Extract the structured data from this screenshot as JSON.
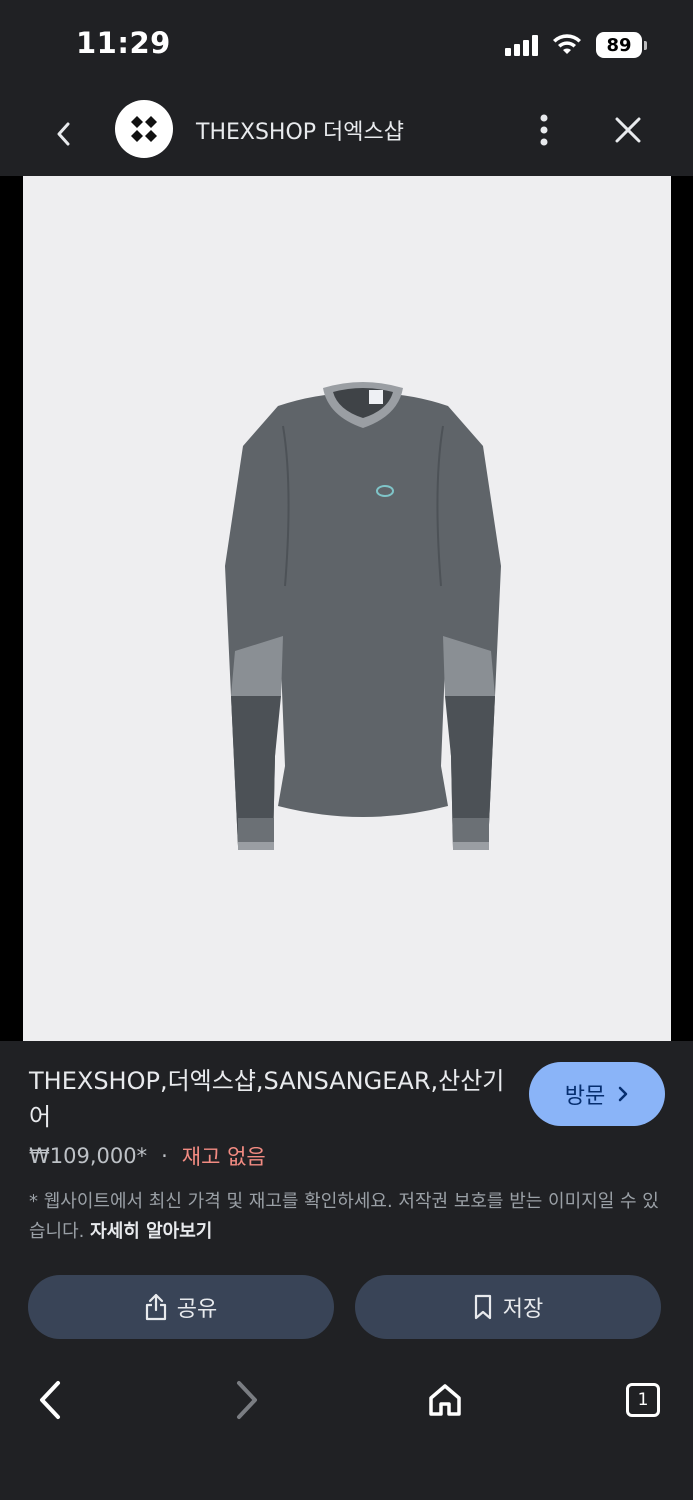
{
  "status_bar": {
    "time": "11:29",
    "battery": "89"
  },
  "header": {
    "site_title": "THEXSHOP 더엑스샵"
  },
  "product": {
    "title": "THEXSHOP,더엑스샵,SANSANGEAR,산산기어",
    "price": "₩109,000*",
    "separator": "·",
    "stock": "재고 없음",
    "disclaimer": "* 웹사이트에서 최신 가격 및 재고를 확인하세요. 저작권 보호를 받는 이미지일 수 있습니다.",
    "learn_more": "자세히 알아보기",
    "visit_label": "방문"
  },
  "actions": {
    "share_label": "공유",
    "save_label": "저장"
  },
  "bottom_nav": {
    "tab_count": "1"
  },
  "colors": {
    "background": "#202124",
    "accent": "#8ab4f8",
    "out_of_stock": "#f28b82",
    "button_bg": "#394457"
  },
  "icons": [
    "back-icon",
    "site-logo-icon",
    "more-vert-icon",
    "close-icon",
    "chevron-right-icon",
    "share-icon",
    "bookmark-icon",
    "home-icon",
    "tabs-icon"
  ]
}
